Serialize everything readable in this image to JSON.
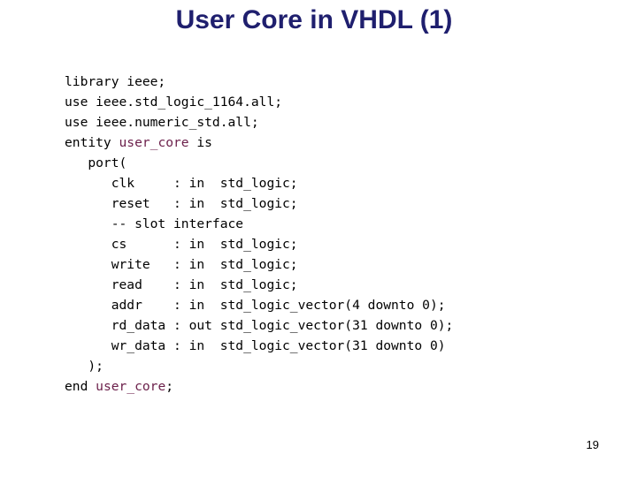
{
  "slide": {
    "title": "User Core in VHDL (1)",
    "page_number": "19",
    "colors": {
      "title": "#1f1f6e",
      "code_text": "#000000",
      "highlighted_identifier": "#6b1f4a"
    }
  },
  "code": {
    "lines": [
      {
        "pre": "library ieee;",
        "ident": "",
        "post": ""
      },
      {
        "pre": "use ieee.std_logic_1164.all;",
        "ident": "",
        "post": ""
      },
      {
        "pre": "use ieee.numeric_std.all;",
        "ident": "",
        "post": ""
      },
      {
        "pre": "entity ",
        "ident": "user_core",
        "post": " is"
      },
      {
        "pre": "   port(",
        "ident": "",
        "post": ""
      },
      {
        "pre": "      clk     : in  std_logic;",
        "ident": "",
        "post": ""
      },
      {
        "pre": "      reset   : in  std_logic;",
        "ident": "",
        "post": ""
      },
      {
        "pre": "      -- slot interface",
        "ident": "",
        "post": ""
      },
      {
        "pre": "      cs      : in  std_logic;",
        "ident": "",
        "post": ""
      },
      {
        "pre": "      write   : in  std_logic;",
        "ident": "",
        "post": ""
      },
      {
        "pre": "      read    : in  std_logic;",
        "ident": "",
        "post": ""
      },
      {
        "pre": "      addr    : in  std_logic_vector(4 downto 0);",
        "ident": "",
        "post": ""
      },
      {
        "pre": "      rd_data : out std_logic_vector(31 downto 0);",
        "ident": "",
        "post": ""
      },
      {
        "pre": "      wr_data : in  std_logic_vector(31 downto 0)",
        "ident": "",
        "post": ""
      },
      {
        "pre": "   );",
        "ident": "",
        "post": ""
      },
      {
        "pre": "end ",
        "ident": "user_core",
        "post": ";"
      }
    ]
  }
}
